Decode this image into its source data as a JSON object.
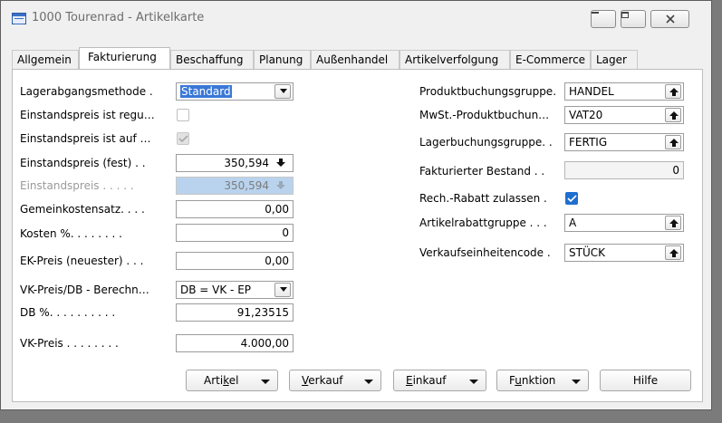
{
  "window": {
    "title": "1000 Tourenrad - Artikelkarte",
    "controls": [
      "minimize-icon",
      "maximize-icon",
      "close-icon"
    ]
  },
  "tabs": [
    {
      "label": "Allgemein",
      "active": false
    },
    {
      "label": "Fakturierung",
      "active": true
    },
    {
      "label": "Beschaffung",
      "active": false
    },
    {
      "label": "Planung",
      "active": false
    },
    {
      "label": "Außenhandel",
      "active": false
    },
    {
      "label": "Artikelverfolgung",
      "active": false
    },
    {
      "label": "E-Commerce",
      "active": false
    },
    {
      "label": "Lager",
      "active": false
    }
  ],
  "left": {
    "lagerabgangsmethode": {
      "label": "Lagerabgangsmethode .",
      "value": "Standard"
    },
    "einstandspreis_reguliert": {
      "label": "Einstandspreis ist regu…",
      "checked": false
    },
    "einstandspreis_auf": {
      "label": "Einstandspreis ist auf …",
      "checked": true,
      "disabled": true
    },
    "einstandspreis_fest": {
      "label": "Einstandspreis (fest) . .",
      "value": "350,594"
    },
    "einstandspreis": {
      "label": "Einstandspreis . . . . .",
      "value": "350,594"
    },
    "gemeinkostensatz": {
      "label": "Gemeinkostensatz. . . .",
      "value": "0,00"
    },
    "kosten_pct": {
      "label": "Kosten %. . . . . . . .",
      "value": "0"
    },
    "ek_preis": {
      "label": "EK-Preis (neuester) . . .",
      "value": "0,00"
    },
    "vk_preis_db": {
      "label": "VK-Preis/DB - Berechn…",
      "value": "DB = VK - EP"
    },
    "db_pct": {
      "label": "DB %. . . . . . . . . .",
      "value": "91,23515"
    },
    "vk_preis": {
      "label": "VK-Preis . . . . . . . .",
      "value": "4.000,00"
    }
  },
  "right": {
    "produktbuchungsgruppe": {
      "label": "Produktbuchungsgruppe.",
      "value": "HANDEL"
    },
    "mwst_produktbuchung": {
      "label": "MwSt.-Produktbuchun…",
      "value": "VAT20"
    },
    "lagerbuchungsgruppe": {
      "label": "Lagerbuchungsgruppe. .",
      "value": "FERTIG"
    },
    "fakturierter_bestand": {
      "label": "Fakturierter Bestand . .",
      "value": "0"
    },
    "rech_rabatt": {
      "label": "Rech.-Rabatt zulassen .",
      "checked": true
    },
    "artikelrabattgruppe": {
      "label": "Artikelrabattgruppe . . .",
      "value": "A"
    },
    "verkaufseinheitencode": {
      "label": "Verkaufseinheitencode .",
      "value": "STÜCK"
    }
  },
  "actions": {
    "artikel": {
      "pre": "Arti",
      "u": "k",
      "post": "el"
    },
    "verkauf": {
      "pre": "",
      "u": "V",
      "post": "erkauf"
    },
    "einkauf": {
      "pre": "",
      "u": "E",
      "post": "inkauf"
    },
    "funktion": {
      "pre": "F",
      "u": "u",
      "post": "nktion"
    },
    "hilfe": {
      "label": "Hilfe"
    }
  },
  "colors": {
    "accent": "#1f6fd0",
    "selection": "#3a78d6",
    "disabled_field": "#b9d3ee"
  }
}
